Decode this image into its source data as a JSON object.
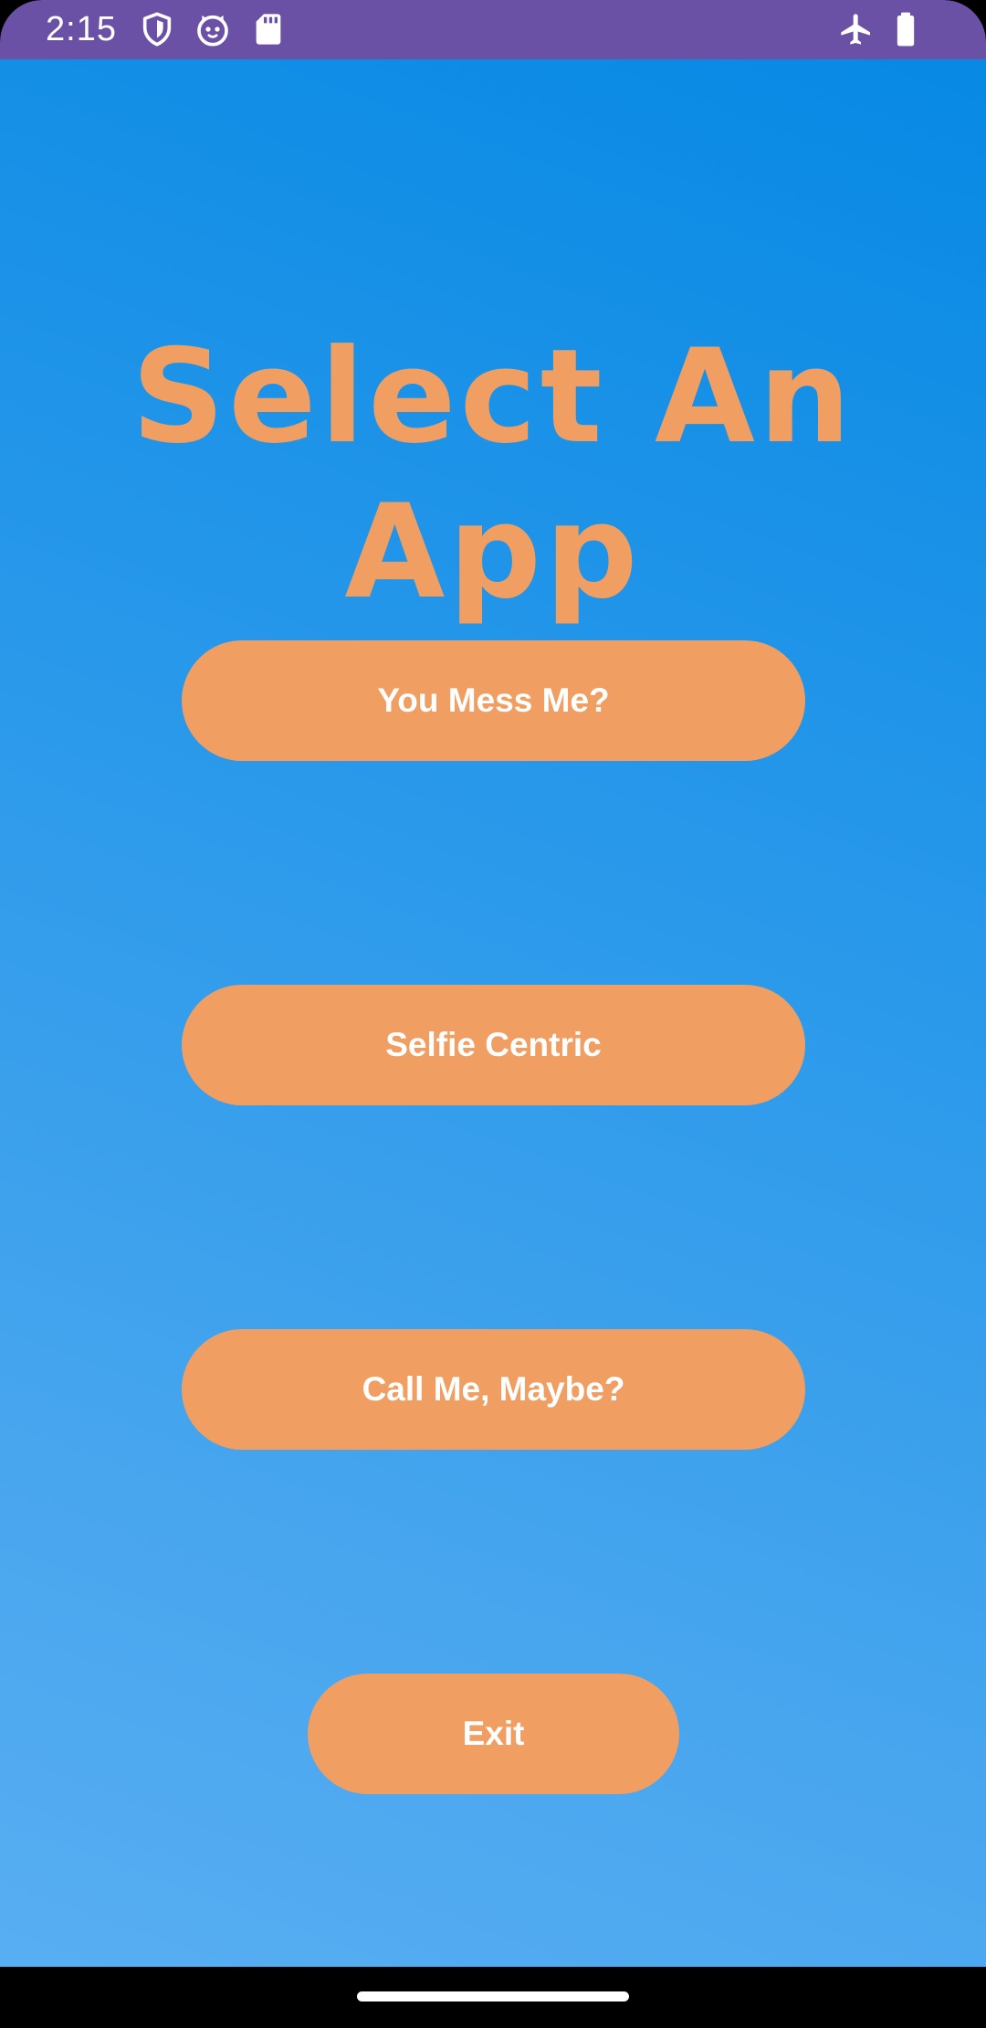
{
  "status_bar": {
    "time": "2:15",
    "background_color": "#6a51a6",
    "left_icons": [
      "shield-icon",
      "cat-face-icon",
      "sd-card-icon"
    ],
    "right_icons": [
      "airplane-mode-icon",
      "battery-icon"
    ]
  },
  "screen": {
    "title": "Select An App",
    "title_color": "#f19e62",
    "buttons": [
      {
        "label": "You Mess Me?"
      },
      {
        "label": "Selfie Centric"
      },
      {
        "label": "Call Me, Maybe?"
      },
      {
        "label": "Exit"
      }
    ],
    "button_color": "#f19e62",
    "gradient_colors": [
      "#0789e4",
      "#58aef2"
    ]
  }
}
